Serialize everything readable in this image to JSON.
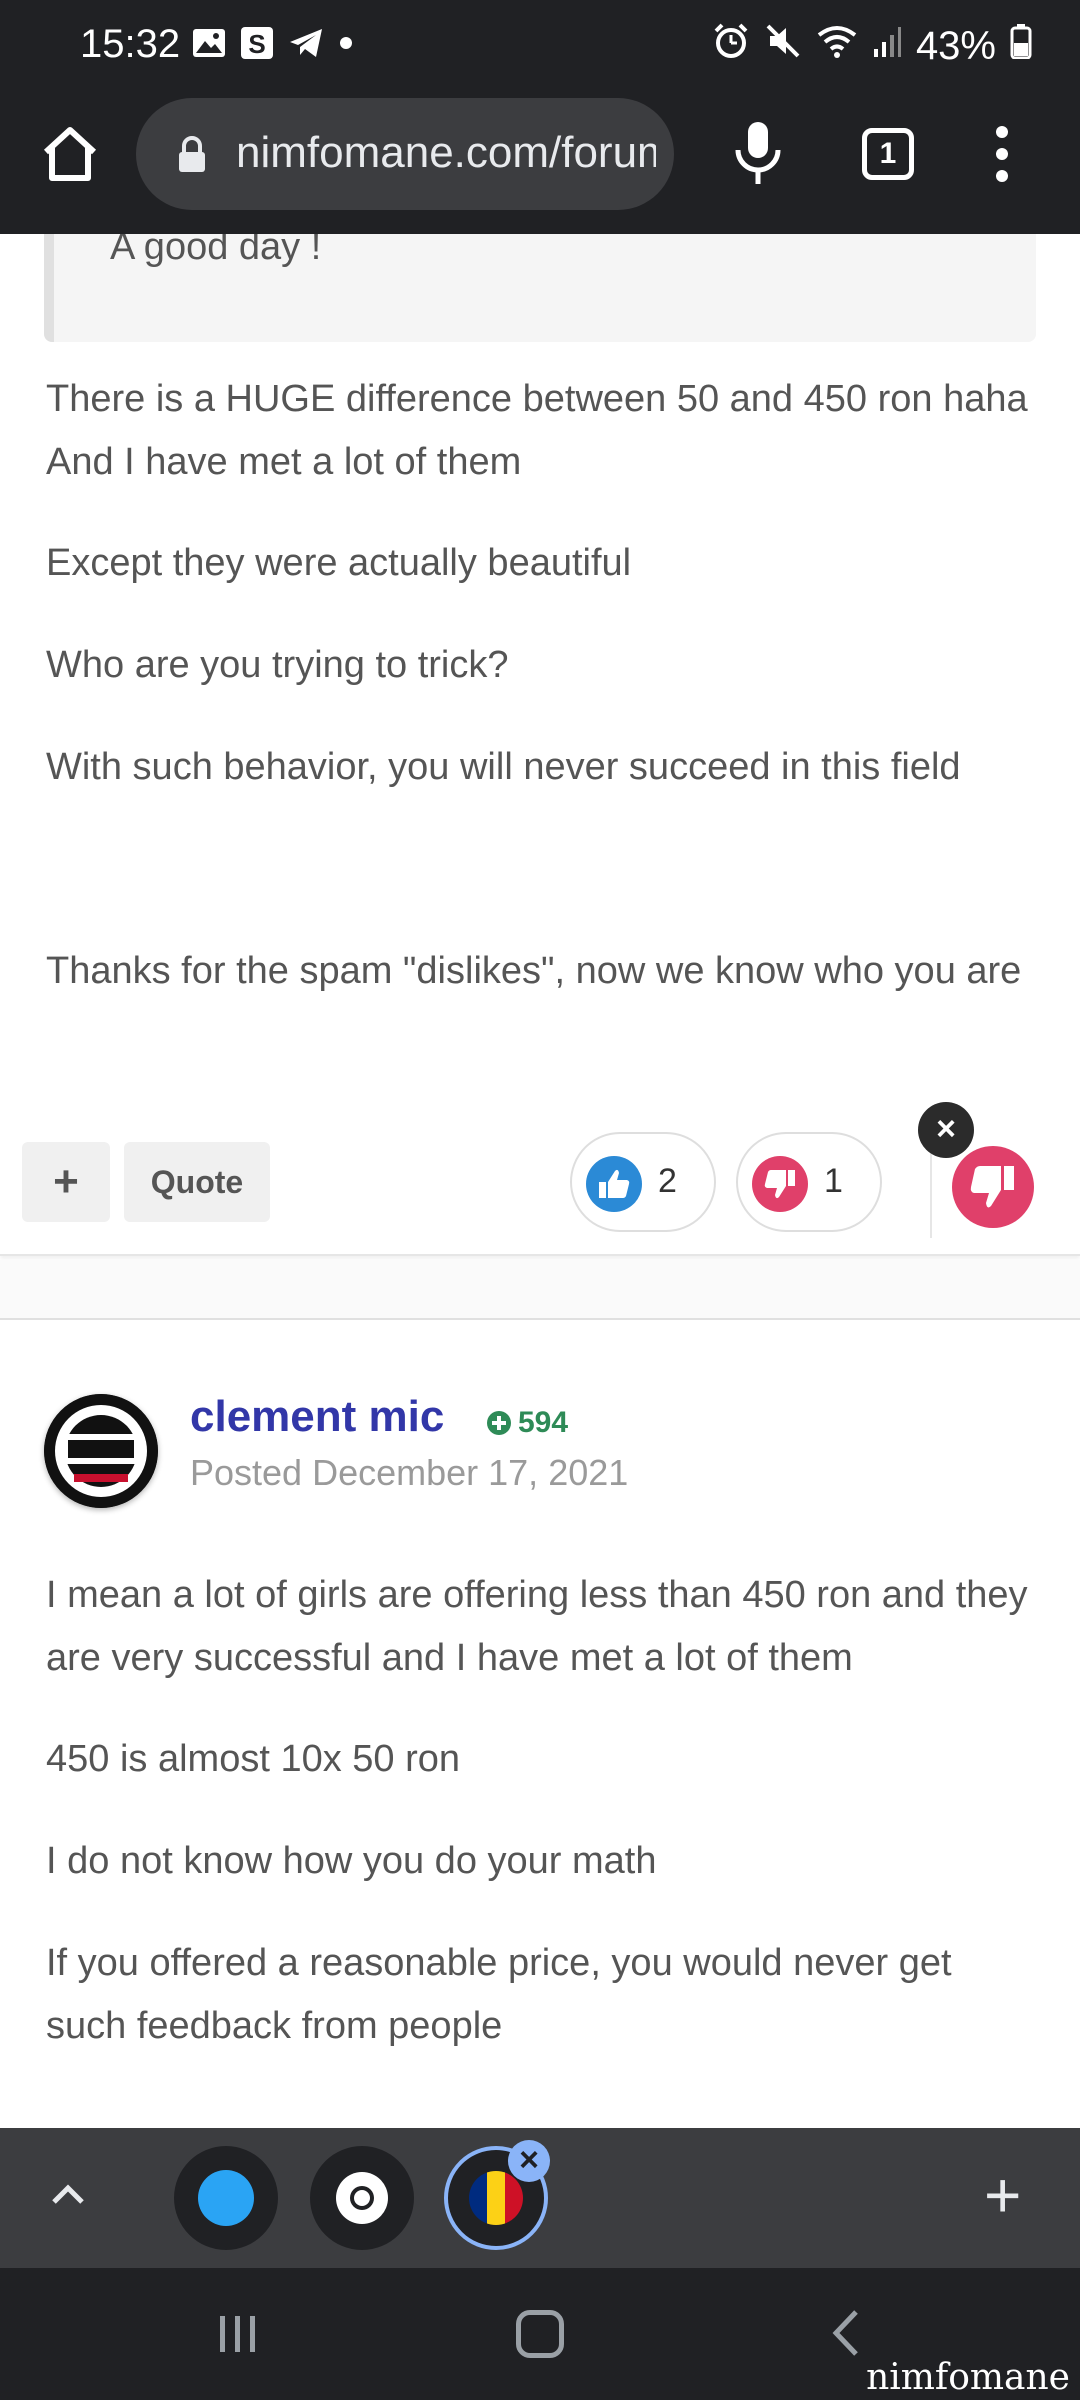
{
  "status_bar": {
    "time": "15:32",
    "battery": "43%"
  },
  "browser": {
    "url": "nimfomane.com/forum",
    "tab_count": "1"
  },
  "post1": {
    "quote_text": "A good day !",
    "paragraphs": [
      "There is a HUGE difference between 50 and 450 ron haha And I have met a lot of them",
      "Except they were actually beautiful",
      "Who are you trying to trick?",
      "With such behavior, you will never succeed in this field",
      "Thanks for the spam \"dislikes\", now we know who you are"
    ],
    "actions": {
      "plus_label": "+",
      "quote_label": "Quote",
      "like_count": "2",
      "dislike_count": "1",
      "close_label": "×"
    }
  },
  "post2": {
    "author": "clement mic",
    "reputation": "594",
    "posted": "Posted December 17, 2021",
    "paragraphs": [
      "I mean a lot of girls are offering less than 450 ron and they are very successful and I have met a lot of them",
      "450 is almost 10x 50 ron",
      "I do not know how you do your math",
      "If you offered a reasonable price, you would never get such feedback from people"
    ]
  },
  "tab_strip": {
    "close_label": "×",
    "new_tab_label": "+"
  },
  "watermark": "nimfomane",
  "colors": {
    "author": "#3237a8",
    "reputation": "#2e8b57",
    "like": "#2b8ad6",
    "dislike": "#e0406a"
  }
}
